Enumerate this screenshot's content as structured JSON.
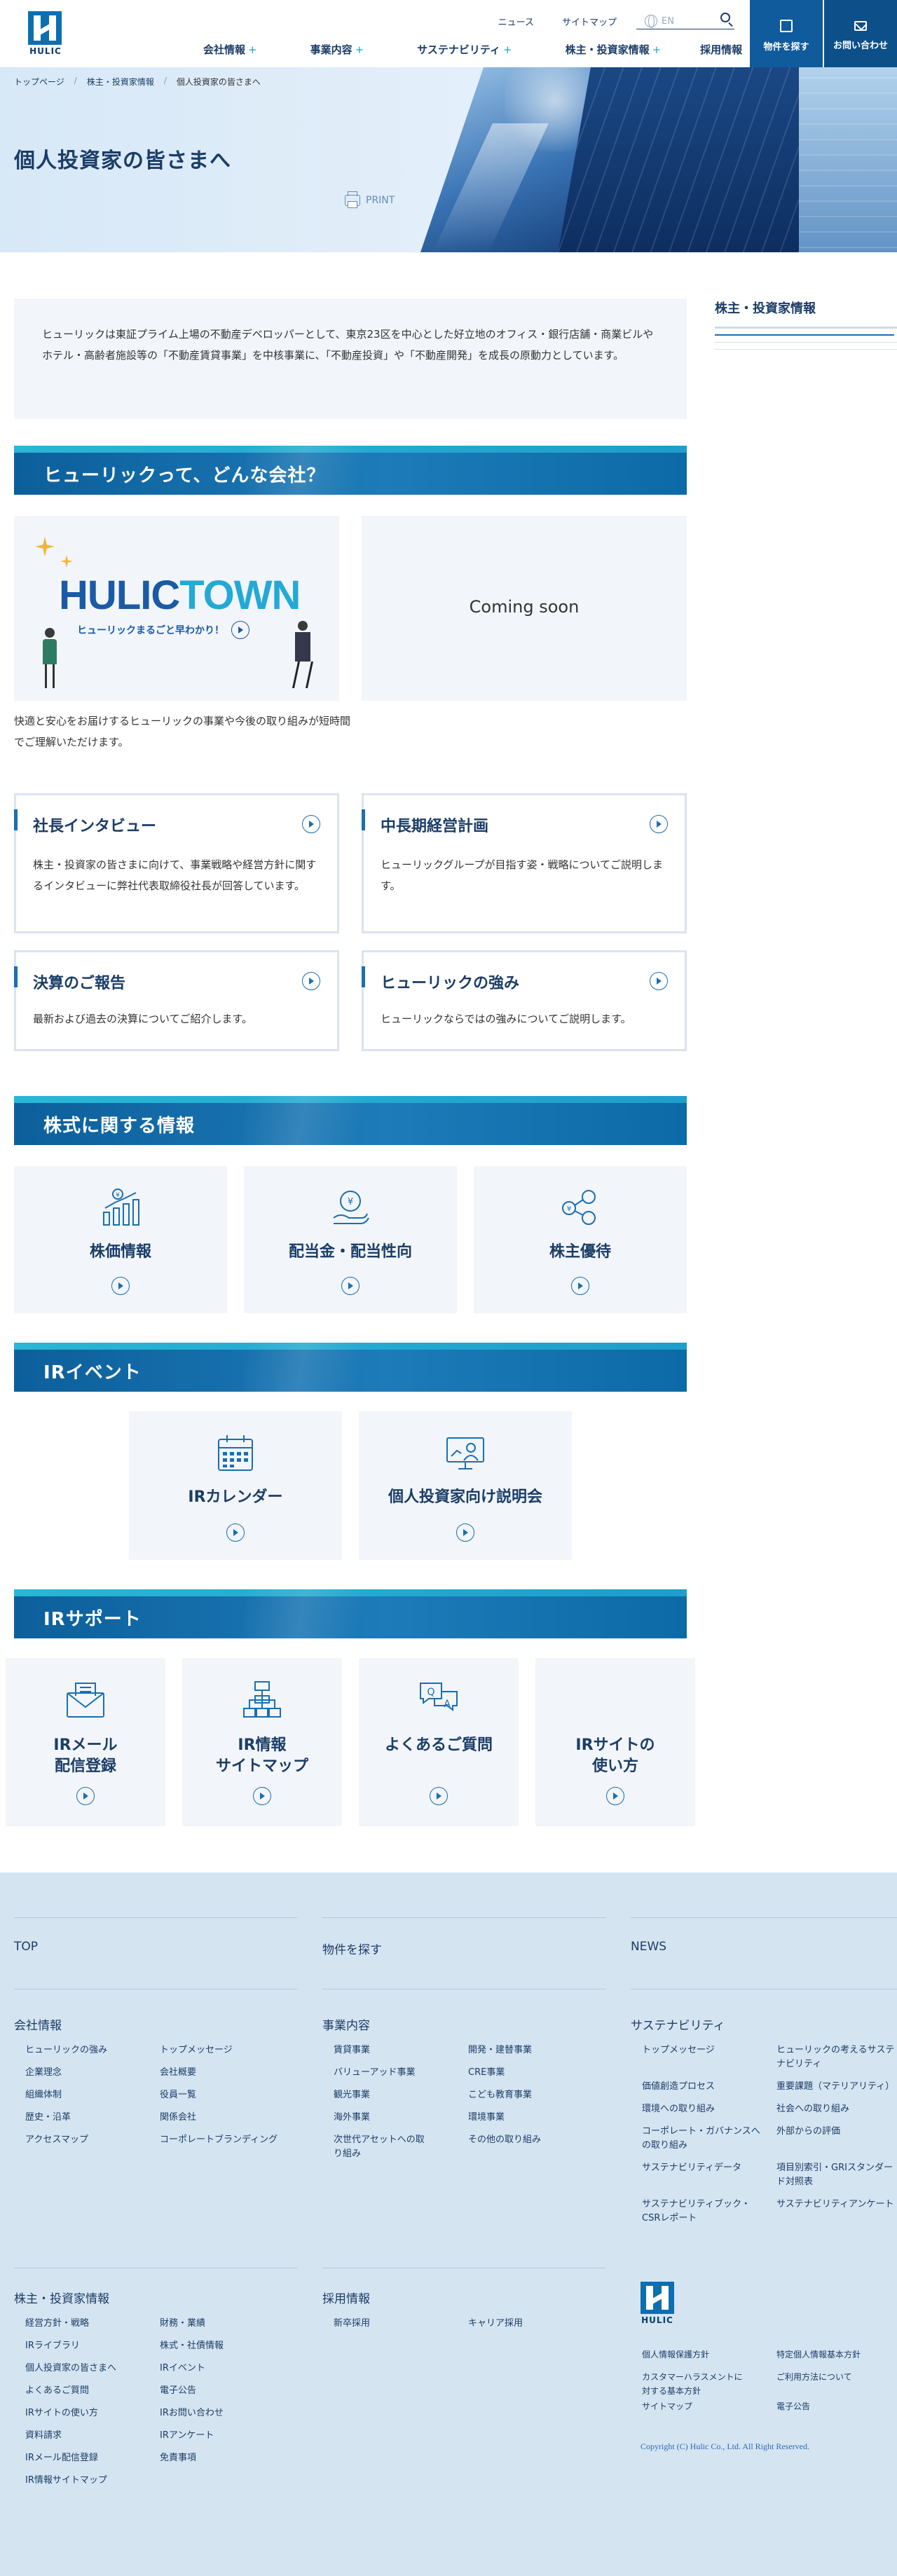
{
  "header": {
    "logo_text": "HULIC",
    "util": {
      "news": "ニュース",
      "sitemap": "サイトマップ",
      "lang": "EN"
    },
    "nav": [
      {
        "label": "会社情報"
      },
      {
        "label": "事業内容"
      },
      {
        "label": "サステナビリティ"
      },
      {
        "label": "株主・投資家情報"
      },
      {
        "label": "採用情報"
      }
    ],
    "cta_property": "物件を探す",
    "cta_contact": "お問い合わせ"
  },
  "breadcrumb": [
    "トップページ",
    "株主・投資家情報",
    "個人投資家の皆さまへ"
  ],
  "page_title": "個人投資家の皆さまへ",
  "print_label": "PRINT",
  "intro": "ヒューリックは東証プライム上場の不動産デベロッパーとして、東京23区を中心とした好立地のオフィス・銀行店舗・商業ビルやホテル・高齢者施設等の「不動産賃貸事業」を中核事業に、「不動産投資」や「不動産開発」を成長の原動力としています。",
  "section_company": {
    "heading": "ヒューリックって、どんな会社？",
    "town_title_1": "HULIC",
    "town_title_2": "TOWN",
    "town_sub": "ヒューリックまるごと早わかり！",
    "coming_soon": "Coming soon",
    "caption": "快適と安心をお届けするヒューリックの事業や今後の取り組みが短時間でご理解いただけます。",
    "cards": [
      {
        "title": "社長インタビュー",
        "desc": "株主・投資家の皆さまに向けて、事業戦略や経営方針に関するインタビューに弊社代表取締役社長が回答しています。"
      },
      {
        "title": "中長期経営計画",
        "desc": "ヒューリックグループが目指す姿・戦略についてご説明します。"
      },
      {
        "title": "決算のご報告",
        "desc": "最新および過去の決算についてご紹介します。"
      },
      {
        "title": "ヒューリックの強み",
        "desc": "ヒューリックならではの強みについてご説明します。"
      }
    ]
  },
  "section_stock": {
    "heading": "株式に関する情報",
    "tiles": [
      {
        "label": "株価情報",
        "icon": "stock-chart-icon"
      },
      {
        "label": "配当金・配当性向",
        "icon": "dividend-icon"
      },
      {
        "label": "株主優待",
        "icon": "shareholder-benefit-icon"
      }
    ]
  },
  "section_event": {
    "heading": "IRイベント",
    "tiles": [
      {
        "label": "IRカレンダー",
        "icon": "calendar-icon"
      },
      {
        "label": "個人投資家向け説明会",
        "icon": "presentation-icon"
      }
    ]
  },
  "section_support": {
    "heading": "IRサポート",
    "tiles": [
      {
        "line1": "IRメール",
        "line2": "配信登録",
        "icon": "mail-icon"
      },
      {
        "line1": "IR情報",
        "line2": "サイトマップ",
        "icon": "sitemap-icon"
      },
      {
        "line1": "よくあるご質問",
        "line2": "",
        "icon": "faq-icon"
      },
      {
        "line1": "IRサイトの",
        "line2": "使い方",
        "icon": "guide-icon"
      }
    ]
  },
  "sidebar": {
    "title": "株主・投資家情報"
  },
  "footer": {
    "top": "TOP",
    "property": "物件を探す",
    "news": "NEWS",
    "company": {
      "title": "会社情報",
      "links": [
        "ヒューリックの強み",
        "トップメッセージ",
        "企業理念",
        "会社概要",
        "組織体制",
        "役員一覧",
        "歴史・沿革",
        "関係会社",
        "アクセスマップ",
        "コーポレートブランディング"
      ]
    },
    "business": {
      "title": "事業内容",
      "links": [
        "賃貸事業",
        "開発・建替事業",
        "バリューアッド事業",
        "CRE事業",
        "観光事業",
        "こども教育事業",
        "海外事業",
        "環境事業",
        "次世代アセットへの取り組み",
        "その他の取り組み"
      ]
    },
    "sustainability": {
      "title": "サステナビリティ",
      "links": [
        "トップメッセージ",
        "ヒューリックの考えるサステナビリティ",
        "価値創造プロセス",
        "重要課題（マテリアリティ）",
        "環境への取り組み",
        "社会への取り組み",
        "コーポレート・ガバナンスへの取り組み",
        "外部からの評価",
        "サステナビリティデータ",
        "項目別索引・GRIスタンダード対照表",
        "サステナビリティブック・CSRレポート",
        "サステナビリティアンケート"
      ]
    },
    "ir": {
      "title": "株主・投資家情報",
      "links": [
        "経営方針・戦略",
        "財務・業績",
        "IRライブラリ",
        "株式・社債情報",
        "個人投資家の皆さまへ",
        "IRイベント",
        "よくあるご質問",
        "電子公告",
        "IRサイトの使い方",
        "IRお問い合わせ",
        "資料請求",
        "IRアンケート",
        "IRメール配信登録",
        "免責事項",
        "IR情報サイトマップ"
      ]
    },
    "recruit": {
      "title": "採用情報",
      "links": [
        "新卒採用",
        "キャリア採用"
      ]
    },
    "policy": {
      "links": [
        "個人情報保護方針",
        "特定個人情報基本方針",
        "カスタマーハラスメントに対する基本方針",
        "ご利用方法について",
        "サイトマップ",
        "電子公告"
      ]
    },
    "logo_text": "HULIC",
    "copyright": "Copyright (C) Hulic Co., Ltd. All Right Reserved."
  }
}
